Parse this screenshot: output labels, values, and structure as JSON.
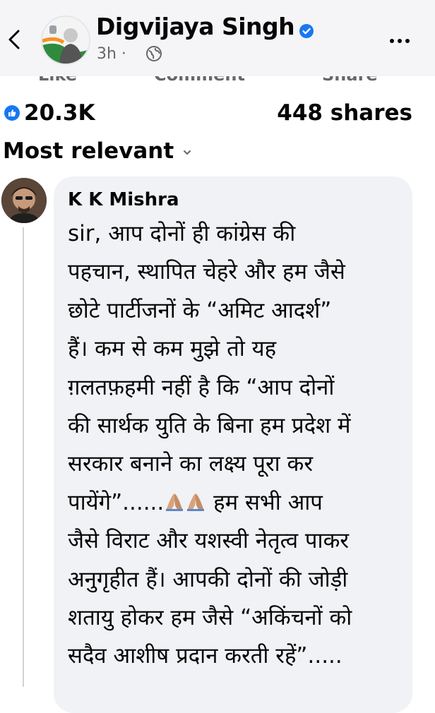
{
  "header": {
    "page_name": "Digvijaya Singh",
    "timestamp": "3h ·",
    "icons": [
      "back-arrow-icon",
      "verified-badge-icon",
      "globe-icon",
      "more-options-icon"
    ]
  },
  "post_actions_cut": {
    "like": "Like",
    "comment": "Comment",
    "share": "Share"
  },
  "reactions": {
    "like_count": "20.3K",
    "shares": "448 shares",
    "like_color": "#1877f2"
  },
  "comments_sort": {
    "label": "Most relevant"
  },
  "comment": {
    "author": "K K Mishra",
    "lines": [
      "sir, आप दोनों ही कांग्रेस की",
      "पहचान, स्थापित चेहरे और हम जैसे",
      "छोटे पार्टीजनों के “अमिट आदर्श”",
      "हैं। कम से कम मुझे तो यह",
      "ग़लतफ़हमी नहीं है कि “आप दोनों",
      "की सार्थक युति के बिना हम प्रदेश में",
      "सरकार बनाने का लक्ष्य पूरा कर"
    ],
    "line8_start": "पायेंगे”......",
    "line8_end": " हम सभी आप",
    "lines_after": [
      "जैसे विराट और यशस्वी नेतृत्व पाकर",
      "अनुगृहीत हैं। आपकी दोनों की जोड़ी",
      "शतायु होकर हम जैसे “अकिंचनों को",
      "सदैव आशीष प्रदान करती रहें”....."
    ],
    "emoji": [
      "folded-hands-icon",
      "folded-hands-icon"
    ]
  },
  "colors": {
    "header_bg": "#f5f5f7",
    "bubble_bg": "#f0f2f5",
    "secondary_text": "#65676b"
  }
}
